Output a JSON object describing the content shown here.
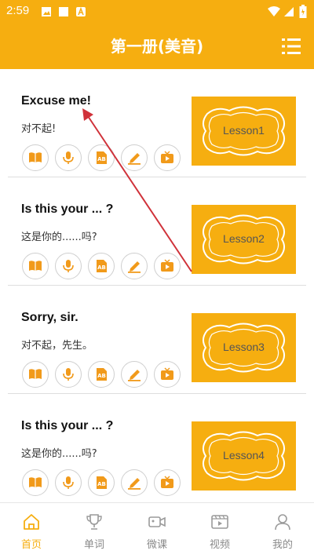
{
  "status": {
    "time": "2:59"
  },
  "header": {
    "title": "第一册(美音)"
  },
  "lessons": [
    {
      "en": "Excuse me!",
      "cn": "对不起!",
      "thumb": "Lesson1"
    },
    {
      "en": "Is this your ... ?",
      "cn": "这是你的......吗?",
      "thumb": "Lesson2"
    },
    {
      "en": "Sorry, sir.",
      "cn": "对不起，先生。",
      "thumb": "Lesson3"
    },
    {
      "en": "Is this your ... ?",
      "cn": "这是你的......吗?",
      "thumb": "Lesson4"
    }
  ],
  "lesson_action_icons": [
    "book-icon",
    "microphone-icon",
    "ab-icon",
    "pencil-icon",
    "tv-icon"
  ],
  "tabs": [
    {
      "label": "首页",
      "icon": "home-icon",
      "active": true
    },
    {
      "label": "单词",
      "icon": "trophy-icon",
      "active": false
    },
    {
      "label": "微课",
      "icon": "video-camera-icon",
      "active": false
    },
    {
      "label": "视频",
      "icon": "video-player-icon",
      "active": false
    },
    {
      "label": "我的",
      "icon": "person-icon",
      "active": false
    }
  ],
  "colors": {
    "accent": "#f6ae10",
    "annotation_arrow": "#d0323a",
    "icon_orange": "#f19a1a"
  }
}
